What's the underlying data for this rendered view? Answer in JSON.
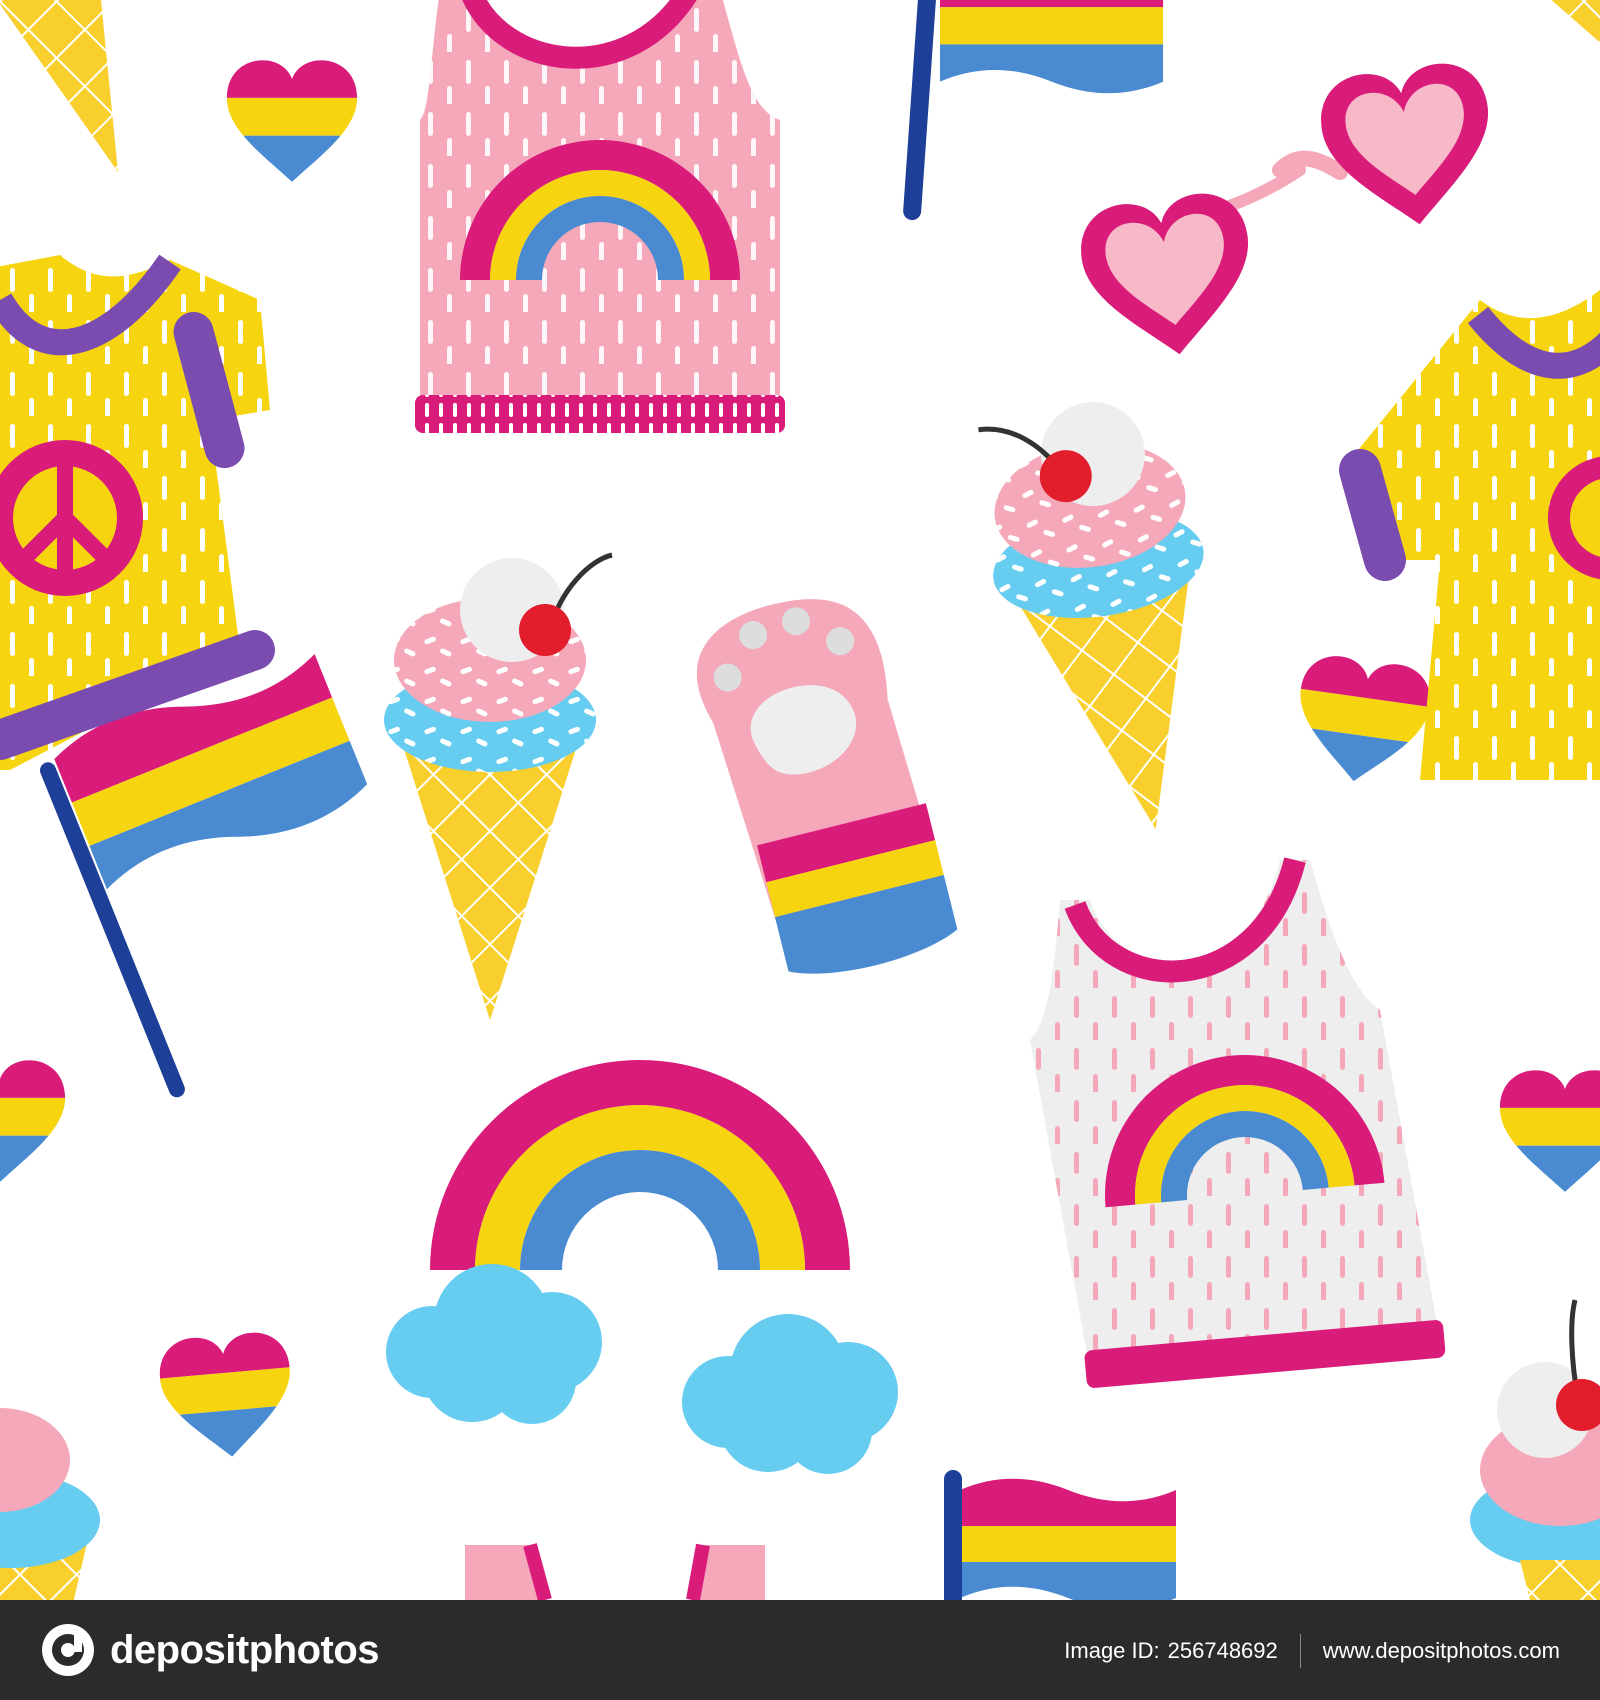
{
  "footer": {
    "brand": "depositphotos",
    "image_id_label": "Image ID:",
    "image_id": "256748692",
    "site_url": "www.depositphotos.com"
  },
  "colors": {
    "magenta": "#d91b7a",
    "yellow": "#f6d510",
    "blue": "#4a8ad1",
    "navy": "#1e3f97",
    "pink": "#f5a8b9",
    "light_pink": "#f7b8c8",
    "sky": "#66ccf0",
    "cherry": "#e21d2c",
    "purple": "#7a4cb0",
    "cone": "#f9cf2e",
    "footer_bg": "#2b2b2b"
  },
  "illustration": {
    "watermark": "depositphotos",
    "motifs": [
      "pansexual-flag",
      "heart",
      "tank-top",
      "t-shirt",
      "peace-sign",
      "ice-cream-cone",
      "cat-paw-glove",
      "rainbow-with-clouds",
      "heart-sunglasses"
    ]
  }
}
